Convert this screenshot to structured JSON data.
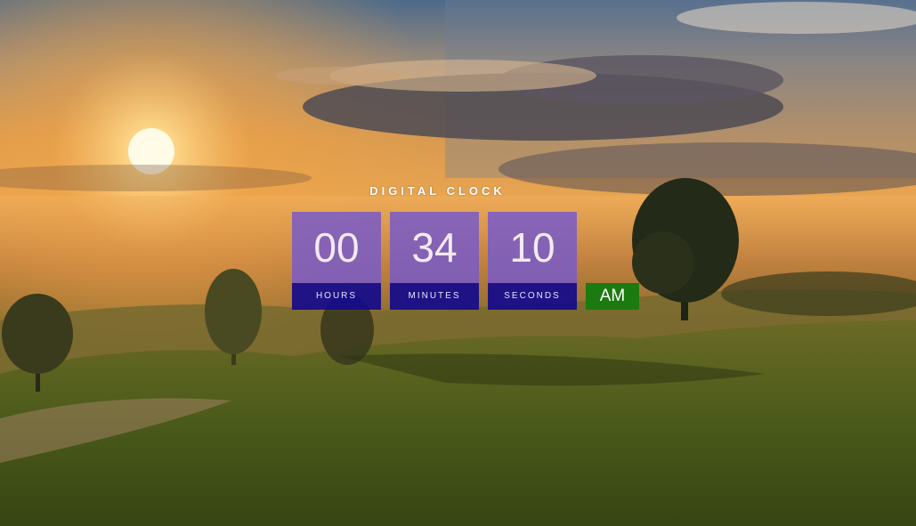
{
  "clock": {
    "title": "DIGITAL CLOCK",
    "hours": {
      "value": "00",
      "label": "HOURS"
    },
    "minutes": {
      "value": "34",
      "label": "MINUTES"
    },
    "seconds": {
      "value": "10",
      "label": "SECONDS"
    },
    "period": "AM"
  },
  "colors": {
    "tile_top": "#785ac8",
    "tile_bottom": "#140a8c",
    "ampm_badge": "#1b7a10"
  }
}
